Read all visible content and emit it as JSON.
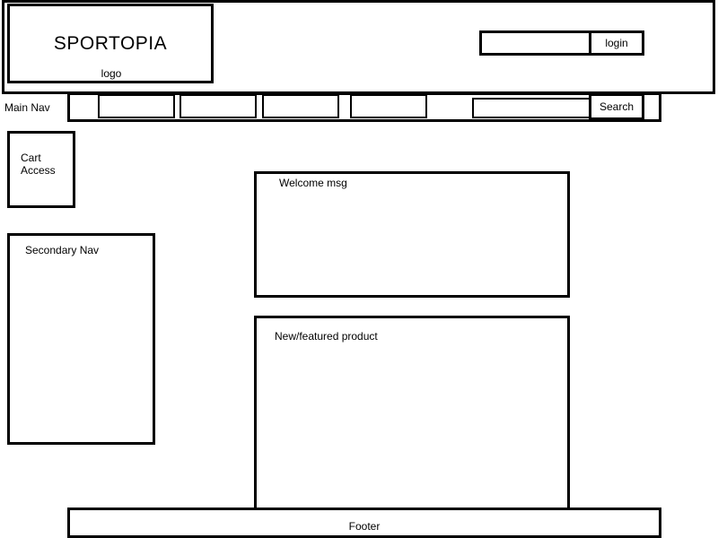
{
  "header": {
    "logo_title": "SPORTOPIA",
    "logo_caption": "logo",
    "login_label": "login"
  },
  "main_nav": {
    "label": "Main Nav",
    "items": [
      "",
      "",
      "",
      ""
    ],
    "search_label": "Search"
  },
  "sidebar": {
    "cart_label": "Cart Access",
    "secondary_nav_label": "Secondary Nav"
  },
  "content": {
    "welcome_label": "Welcome msg",
    "featured_label": "New/featured product"
  },
  "footer": {
    "label": "Footer"
  }
}
